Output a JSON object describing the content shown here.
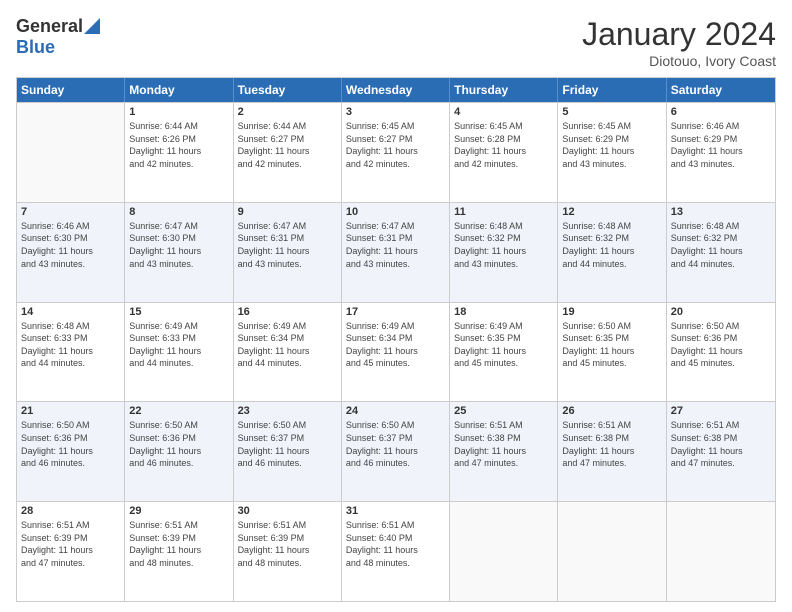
{
  "logo": {
    "general": "General",
    "blue": "Blue"
  },
  "title": "January 2024",
  "subtitle": "Diotouo, Ivory Coast",
  "days": [
    "Sunday",
    "Monday",
    "Tuesday",
    "Wednesday",
    "Thursday",
    "Friday",
    "Saturday"
  ],
  "weeks": [
    [
      {
        "day": "",
        "content": ""
      },
      {
        "day": "1",
        "content": "Sunrise: 6:44 AM\nSunset: 6:26 PM\nDaylight: 11 hours\nand 42 minutes."
      },
      {
        "day": "2",
        "content": "Sunrise: 6:44 AM\nSunset: 6:27 PM\nDaylight: 11 hours\nand 42 minutes."
      },
      {
        "day": "3",
        "content": "Sunrise: 6:45 AM\nSunset: 6:27 PM\nDaylight: 11 hours\nand 42 minutes."
      },
      {
        "day": "4",
        "content": "Sunrise: 6:45 AM\nSunset: 6:28 PM\nDaylight: 11 hours\nand 42 minutes."
      },
      {
        "day": "5",
        "content": "Sunrise: 6:45 AM\nSunset: 6:29 PM\nDaylight: 11 hours\nand 43 minutes."
      },
      {
        "day": "6",
        "content": "Sunrise: 6:46 AM\nSunset: 6:29 PM\nDaylight: 11 hours\nand 43 minutes."
      }
    ],
    [
      {
        "day": "7",
        "content": "Sunrise: 6:46 AM\nSunset: 6:30 PM\nDaylight: 11 hours\nand 43 minutes."
      },
      {
        "day": "8",
        "content": "Sunrise: 6:47 AM\nSunset: 6:30 PM\nDaylight: 11 hours\nand 43 minutes."
      },
      {
        "day": "9",
        "content": "Sunrise: 6:47 AM\nSunset: 6:31 PM\nDaylight: 11 hours\nand 43 minutes."
      },
      {
        "day": "10",
        "content": "Sunrise: 6:47 AM\nSunset: 6:31 PM\nDaylight: 11 hours\nand 43 minutes."
      },
      {
        "day": "11",
        "content": "Sunrise: 6:48 AM\nSunset: 6:32 PM\nDaylight: 11 hours\nand 43 minutes."
      },
      {
        "day": "12",
        "content": "Sunrise: 6:48 AM\nSunset: 6:32 PM\nDaylight: 11 hours\nand 44 minutes."
      },
      {
        "day": "13",
        "content": "Sunrise: 6:48 AM\nSunset: 6:32 PM\nDaylight: 11 hours\nand 44 minutes."
      }
    ],
    [
      {
        "day": "14",
        "content": "Sunrise: 6:48 AM\nSunset: 6:33 PM\nDaylight: 11 hours\nand 44 minutes."
      },
      {
        "day": "15",
        "content": "Sunrise: 6:49 AM\nSunset: 6:33 PM\nDaylight: 11 hours\nand 44 minutes."
      },
      {
        "day": "16",
        "content": "Sunrise: 6:49 AM\nSunset: 6:34 PM\nDaylight: 11 hours\nand 44 minutes."
      },
      {
        "day": "17",
        "content": "Sunrise: 6:49 AM\nSunset: 6:34 PM\nDaylight: 11 hours\nand 45 minutes."
      },
      {
        "day": "18",
        "content": "Sunrise: 6:49 AM\nSunset: 6:35 PM\nDaylight: 11 hours\nand 45 minutes."
      },
      {
        "day": "19",
        "content": "Sunrise: 6:50 AM\nSunset: 6:35 PM\nDaylight: 11 hours\nand 45 minutes."
      },
      {
        "day": "20",
        "content": "Sunrise: 6:50 AM\nSunset: 6:36 PM\nDaylight: 11 hours\nand 45 minutes."
      }
    ],
    [
      {
        "day": "21",
        "content": "Sunrise: 6:50 AM\nSunset: 6:36 PM\nDaylight: 11 hours\nand 46 minutes."
      },
      {
        "day": "22",
        "content": "Sunrise: 6:50 AM\nSunset: 6:36 PM\nDaylight: 11 hours\nand 46 minutes."
      },
      {
        "day": "23",
        "content": "Sunrise: 6:50 AM\nSunset: 6:37 PM\nDaylight: 11 hours\nand 46 minutes."
      },
      {
        "day": "24",
        "content": "Sunrise: 6:50 AM\nSunset: 6:37 PM\nDaylight: 11 hours\nand 46 minutes."
      },
      {
        "day": "25",
        "content": "Sunrise: 6:51 AM\nSunset: 6:38 PM\nDaylight: 11 hours\nand 47 minutes."
      },
      {
        "day": "26",
        "content": "Sunrise: 6:51 AM\nSunset: 6:38 PM\nDaylight: 11 hours\nand 47 minutes."
      },
      {
        "day": "27",
        "content": "Sunrise: 6:51 AM\nSunset: 6:38 PM\nDaylight: 11 hours\nand 47 minutes."
      }
    ],
    [
      {
        "day": "28",
        "content": "Sunrise: 6:51 AM\nSunset: 6:39 PM\nDaylight: 11 hours\nand 47 minutes."
      },
      {
        "day": "29",
        "content": "Sunrise: 6:51 AM\nSunset: 6:39 PM\nDaylight: 11 hours\nand 48 minutes."
      },
      {
        "day": "30",
        "content": "Sunrise: 6:51 AM\nSunset: 6:39 PM\nDaylight: 11 hours\nand 48 minutes."
      },
      {
        "day": "31",
        "content": "Sunrise: 6:51 AM\nSunset: 6:40 PM\nDaylight: 11 hours\nand 48 minutes."
      },
      {
        "day": "",
        "content": ""
      },
      {
        "day": "",
        "content": ""
      },
      {
        "day": "",
        "content": ""
      }
    ]
  ]
}
